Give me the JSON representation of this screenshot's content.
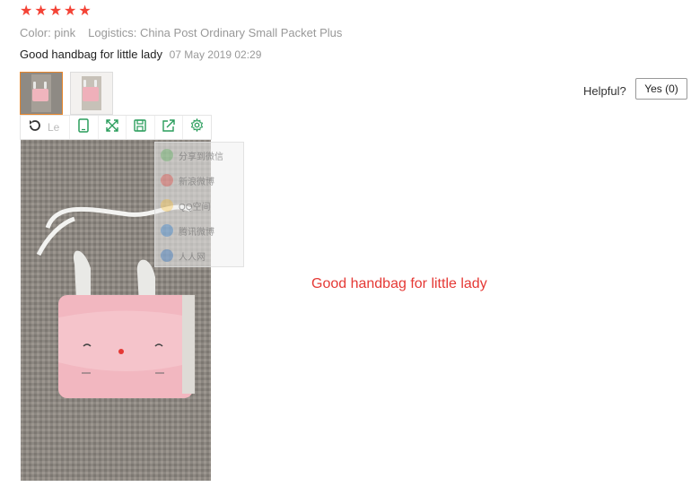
{
  "rating": {
    "stars": 5,
    "star_glyph": "★",
    "color": "#f44336"
  },
  "attributes": {
    "color": "Color: pink",
    "logistics": "Logistics: China Post Ordinary Small Packet Plus"
  },
  "review": {
    "text": "Good handbag for little lady",
    "date": "07 May 2019 02:29"
  },
  "helpful": {
    "label": "Helpful?",
    "yes_button": "Yes (0)"
  },
  "viewer_toolbar": {
    "rotate_label": "Le",
    "buttons": [
      "phone-icon",
      "fullscreen-icon",
      "save-icon",
      "share-icon",
      "gear-icon"
    ],
    "accent": "#2a9d5c"
  },
  "share_menu": {
    "items": [
      "分享到微信",
      "新浪微博",
      "QQ空间",
      "腾讯微博",
      "人人网"
    ],
    "icon_colors": [
      "#4caf50",
      "#e53935",
      "#fbc02d",
      "#1976d2",
      "#1565c0"
    ]
  },
  "caption": "Good handbag for little lady",
  "accent_orange": "#e6862b"
}
